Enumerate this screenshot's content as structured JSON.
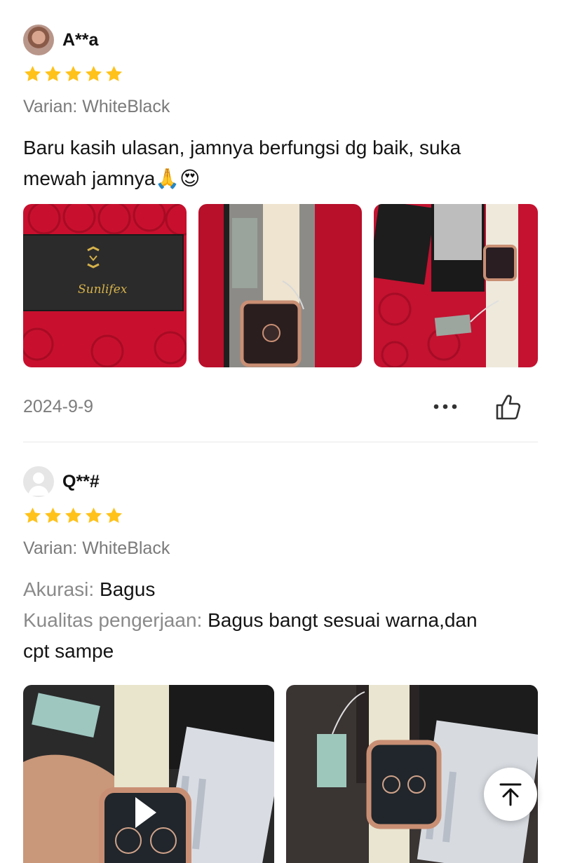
{
  "reviews": [
    {
      "username": "A**a",
      "rating": 5,
      "variant": "Varian: WhiteBlack",
      "text_line1": "Baru kasih ulasan, jamnya berfungsi dg baik, suka",
      "text_line2": "mewah jamnya🙏😍",
      "date": "2024-9-9",
      "photo_brand": "Sunlifex"
    },
    {
      "username": "Q**#",
      "rating": 5,
      "variant": "Varian: WhiteBlack",
      "accuracy_label": "Akurasi:",
      "accuracy_value": "Bagus",
      "quality_label": "Kualitas pengerjaan:",
      "quality_value_line1": "Bagus bangt sesuai warna,dan",
      "quality_value_line2": "cpt sampe"
    }
  ],
  "colors": {
    "star": "#ffc21a",
    "text": "#141414",
    "muted": "#7a7a7a",
    "divider": "#e8e8e8"
  },
  "icons": {
    "more": "more-horizontal-icon",
    "like": "thumbs-up-icon",
    "back_to_top": "arrow-up-to-top-icon"
  }
}
